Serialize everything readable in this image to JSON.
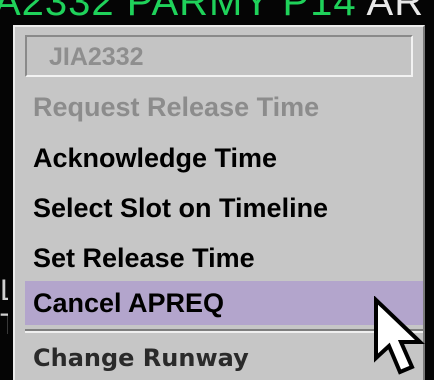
{
  "background": {
    "datablock_text": "A2332 PARMY P14 ",
    "datablock_tail": "AR",
    "left_marks": [
      "L",
      "T"
    ]
  },
  "context_menu": {
    "header": "JIA2332",
    "items": [
      {
        "label": "Request Release Time",
        "enabled": false,
        "highlighted": false
      },
      {
        "label": "Acknowledge Time",
        "enabled": true,
        "highlighted": false
      },
      {
        "label": "Select Slot on Timeline",
        "enabled": true,
        "highlighted": false
      },
      {
        "label": "Set Release Time",
        "enabled": true,
        "highlighted": false
      },
      {
        "label": "Cancel APREQ",
        "enabled": true,
        "highlighted": true
      },
      {
        "label": "Change Runway",
        "enabled": true,
        "highlighted": false
      }
    ]
  },
  "colors": {
    "menu_background": "#c6c6c6",
    "highlight": "#b3a5cc",
    "disabled_text": "#8c8c8c",
    "datablock_green": "#1fd25a",
    "screen_background": "#050505"
  },
  "icons": {
    "pointer": "mouse-pointer-arrow-icon"
  }
}
